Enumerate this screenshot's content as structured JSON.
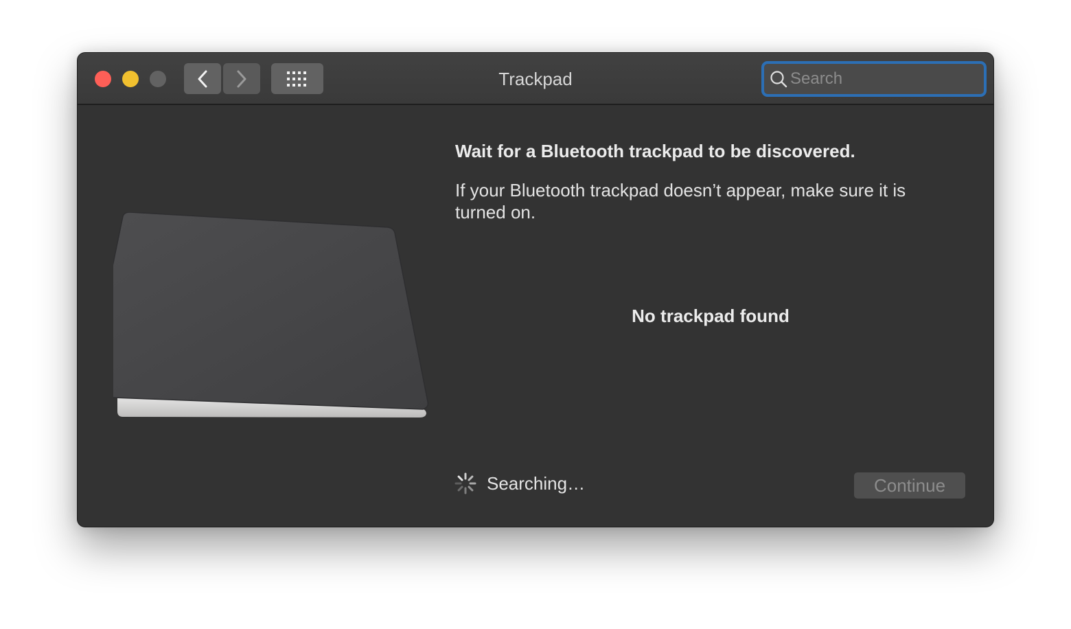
{
  "window": {
    "title": "Trackpad"
  },
  "toolbar": {
    "back_icon": "chevron-left-icon",
    "forward_icon": "chevron-right-icon",
    "show_all_icon": "grid-icon",
    "search_placeholder": "Search",
    "search_value": ""
  },
  "main": {
    "heading": "Wait for a Bluetooth trackpad to be discovered.",
    "description": "If your Bluetooth trackpad doesn’t appear, make sure it is turned on.",
    "empty_state": "No trackpad found",
    "status": "Searching…",
    "continue_label": "Continue"
  },
  "colors": {
    "close": "#fe5f57",
    "minimize": "#f1c02f",
    "focus_ring": "#2c6fb5"
  }
}
